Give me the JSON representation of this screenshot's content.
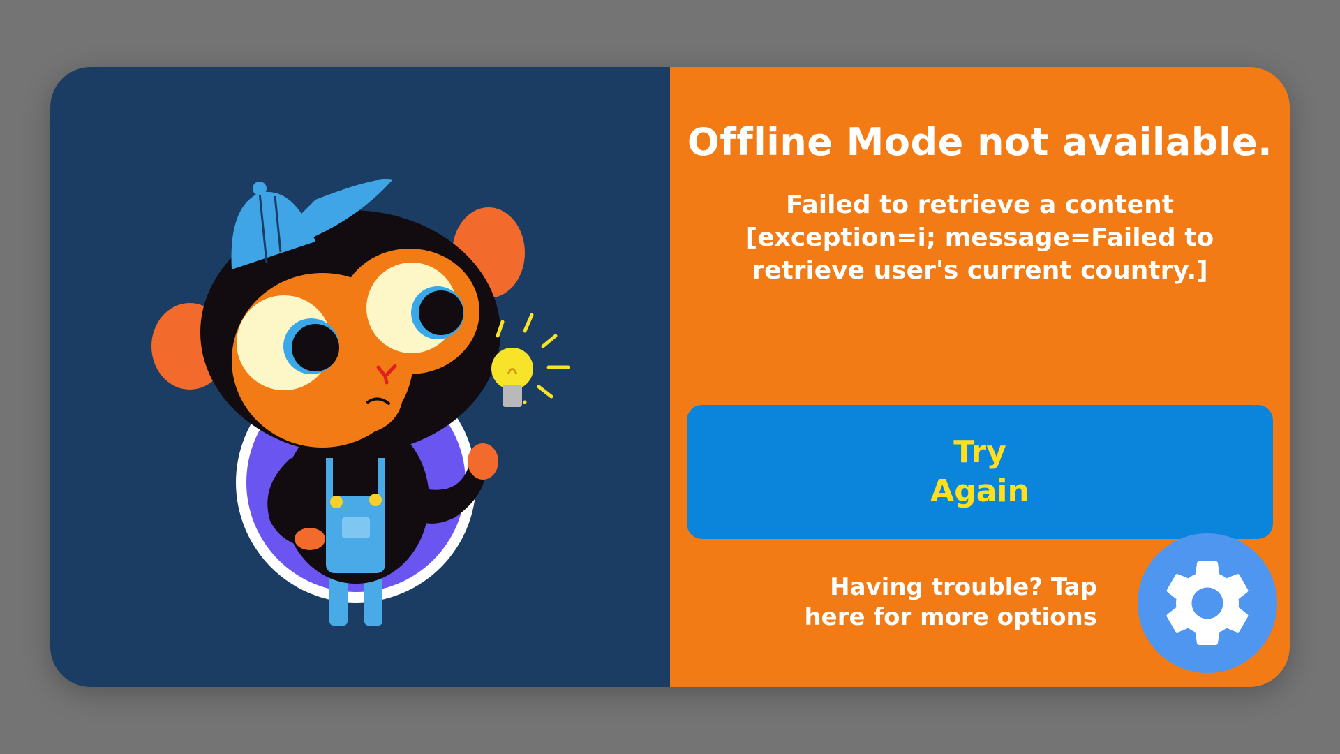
{
  "dialog": {
    "title": "Offline Mode not available.",
    "message": "Failed to retrieve a content [exception=i; message=Failed to retrieve user's current country.]",
    "try_again_line1": "Try",
    "try_again_line2": "Again",
    "trouble_text": "Having trouble? Tap here for more options",
    "settings_icon": "gear-icon",
    "mascot_icon": "monkey-with-lightbulb-illustration"
  },
  "colors": {
    "left_panel": "#1b3d63",
    "right_panel": "#f37b15",
    "button": "#0b85dc",
    "button_text": "#ffe01b",
    "settings_circle": "#4e96ef"
  }
}
